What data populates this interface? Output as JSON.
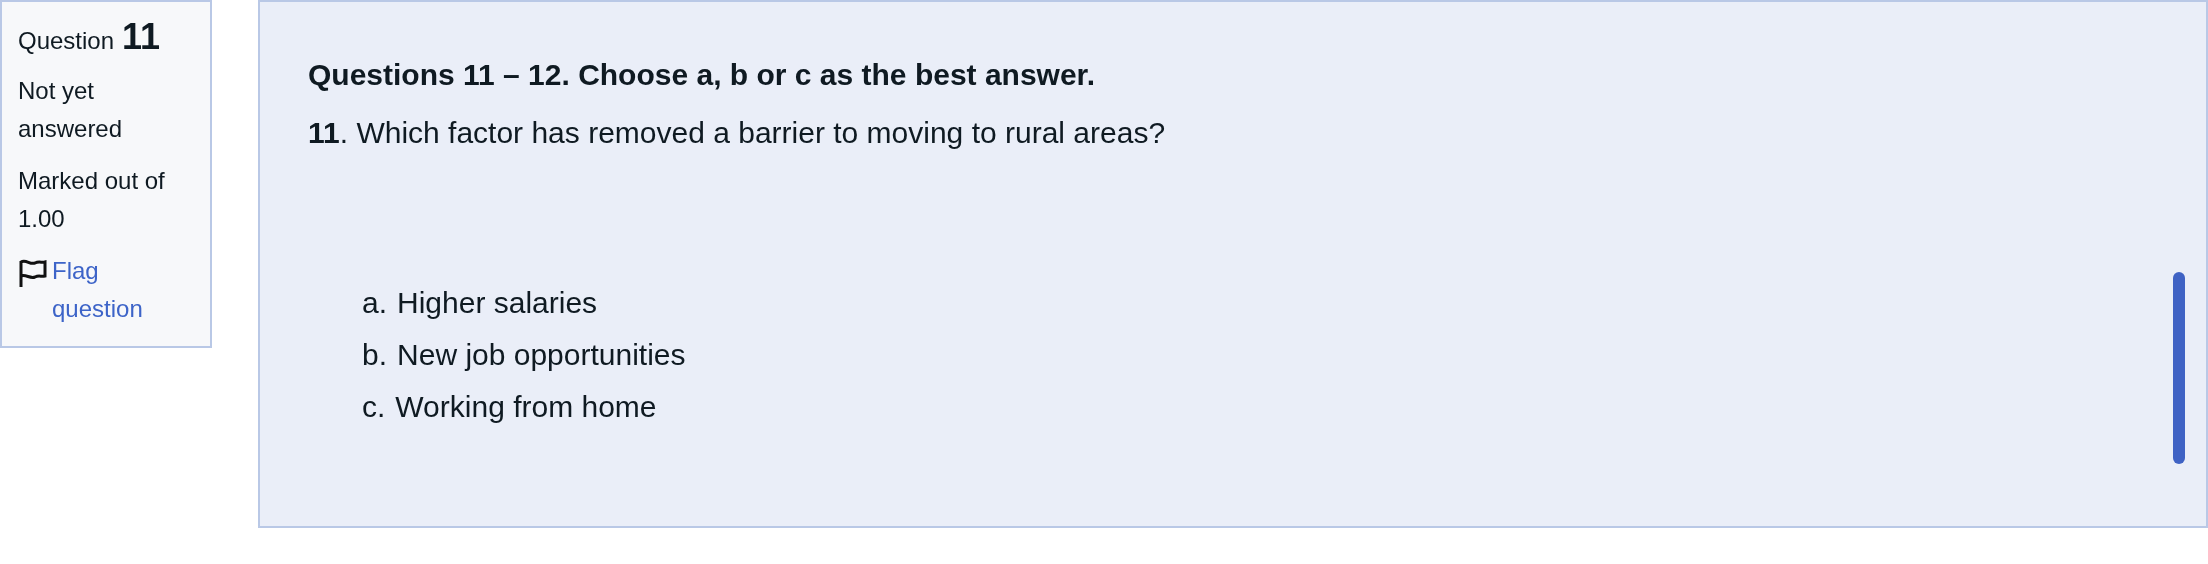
{
  "info": {
    "label": "Question",
    "number": "11",
    "status": "Not yet answered",
    "marks": "Marked out of 1.00",
    "flag": {
      "label": "Flag question",
      "flagged": false
    }
  },
  "question": {
    "instructions": "Questions 11 – 12. Choose a, b or c as the best answer.",
    "text": "**11**. Which factor has removed a barrier to moving to rural areas?",
    "options": [
      {
        "letter": "a.",
        "text": "Higher salaries"
      },
      {
        "letter": "b.",
        "text": "New job opportunities"
      },
      {
        "letter": "c.",
        "text": "Working from home"
      }
    ]
  }
}
